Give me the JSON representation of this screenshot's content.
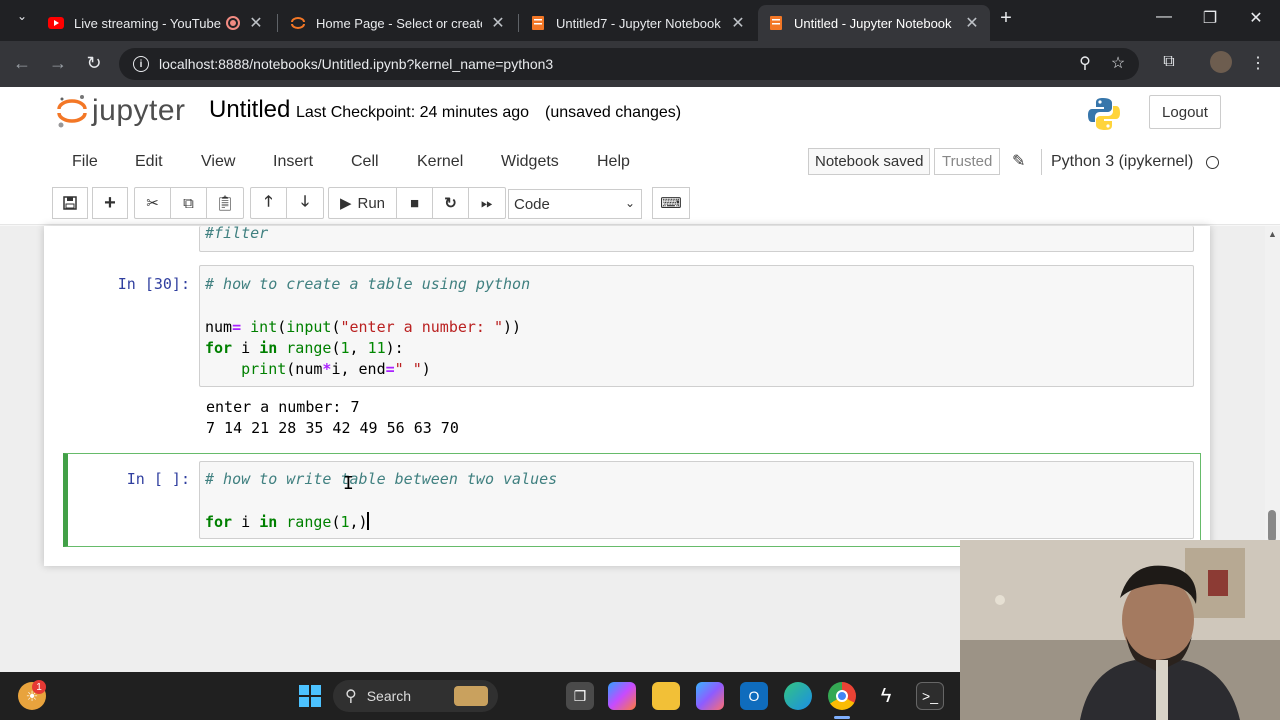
{
  "browser": {
    "tabs": [
      {
        "title": "Live streaming - YouTube St",
        "icon": "youtube-icon",
        "active": false
      },
      {
        "title": "Home Page - Select or create a",
        "icon": "jupyter-icon",
        "active": false
      },
      {
        "title": "Untitled7 - Jupyter Notebook",
        "icon": "notebook-icon",
        "active": false
      },
      {
        "title": "Untitled - Jupyter Notebook",
        "icon": "notebook-icon",
        "active": true
      }
    ],
    "url": "localhost:8888/notebooks/Untitled.ipynb?kernel_name=python3"
  },
  "jupyter": {
    "logo_text": "jupyter",
    "notebook_name": "Untitled",
    "checkpoint": "Last Checkpoint: 24 minutes ago",
    "unsaved": "(unsaved changes)",
    "logout": "Logout",
    "menu": [
      "File",
      "Edit",
      "View",
      "Insert",
      "Cell",
      "Kernel",
      "Widgets",
      "Help"
    ],
    "notebook_saved": "Notebook saved",
    "trusted": "Trusted",
    "kernel": "Python 3 (ipykernel)",
    "toolbar": {
      "run_label": "Run",
      "cell_type": "Code"
    }
  },
  "cells": {
    "partial": {
      "line": "#filter"
    },
    "cell30": {
      "prompt": "In [30]:",
      "comment": "# how to create a table using python",
      "output": [
        "enter a number: 7",
        "7 14 21 28 35 42 49 56 63 70"
      ]
    },
    "cell_current": {
      "prompt": "In [ ]:",
      "comment": "# how to write table between two values"
    }
  },
  "taskbar": {
    "search": "Search",
    "badge": "1"
  }
}
